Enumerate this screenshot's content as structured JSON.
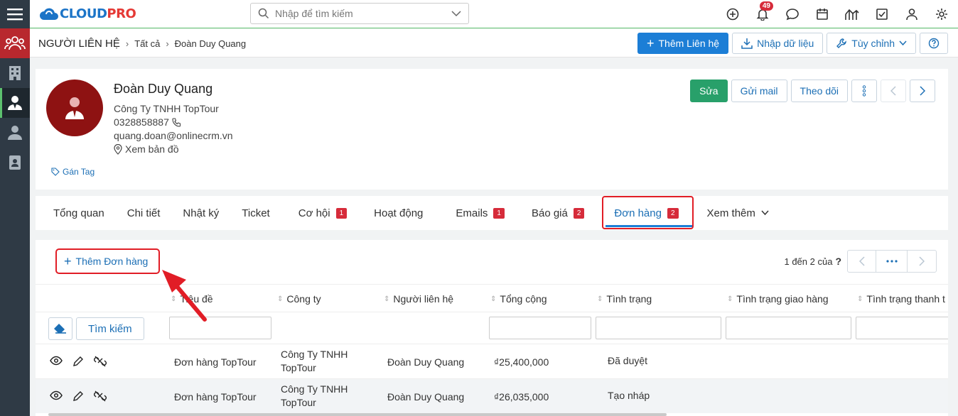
{
  "app": {
    "logo_text_main": "CLOUD",
    "logo_text_accent": "PRO",
    "search_placeholder": "Nhập để tìm kiếm",
    "notification_count": "49"
  },
  "breadcrumb": {
    "module": "NGƯỜI LIÊN HỆ",
    "all": "Tất cả",
    "current": "Đoàn Duy Quang",
    "add_contact": "Thêm Liên hệ",
    "import": "Nhập dữ liệu",
    "customize": "Tùy chỉnh"
  },
  "contact": {
    "name": "Đoàn Duy Quang",
    "company": "Công Ty TNHH TopTour",
    "phone": "0328858887",
    "email": "quang.doan@onlinecrm.vn",
    "map": "Xem bản đồ",
    "tag": "Gán Tag",
    "edit": "Sửa",
    "send_mail": "Gửi mail",
    "follow": "Theo dõi"
  },
  "tabs": [
    {
      "label": "Tổng quan",
      "count": ""
    },
    {
      "label": "Chi tiết",
      "count": ""
    },
    {
      "label": "Nhật ký",
      "count": ""
    },
    {
      "label": "Ticket",
      "count": ""
    },
    {
      "label": "Cơ hội",
      "count": "1"
    },
    {
      "label": "Hoạt động",
      "count": ""
    },
    {
      "label": "Emails",
      "count": "1"
    },
    {
      "label": "Báo giá",
      "count": "2"
    },
    {
      "label": "Đơn hàng",
      "count": "2"
    },
    {
      "label": "Xem thêm",
      "count": ""
    }
  ],
  "orders": {
    "add_label": "Thêm Đơn hàng",
    "pager_text": "1 đến 2 của",
    "pager_help": "?",
    "search_label": "Tìm kiếm",
    "columns": [
      "Tiêu đề",
      "Công ty",
      "Người liên hệ",
      "Tổng cộng",
      "Tình trạng",
      "Tình trạng giao hàng",
      "Tình trạng thanh t"
    ],
    "rows": [
      {
        "title": "Đơn hàng TopTour",
        "company_l1": "Công Ty TNHH",
        "company_l2": "TopTour",
        "contact": "Đoàn Duy Quang",
        "total": "₫25,400,000",
        "status": "Đã duyệt"
      },
      {
        "title": "Đơn hàng TopTour",
        "company_l1": "Công Ty TNHH",
        "company_l2": "TopTour",
        "contact": "Đoàn Duy Quang",
        "total": "₫26,035,000",
        "status": "Tạo nháp"
      }
    ]
  },
  "colors": {
    "primary": "#1c7ed6",
    "accent_red": "#e11d26",
    "badge": "#d62b3a",
    "success": "#28a06a",
    "rail": "#2f3a45"
  }
}
